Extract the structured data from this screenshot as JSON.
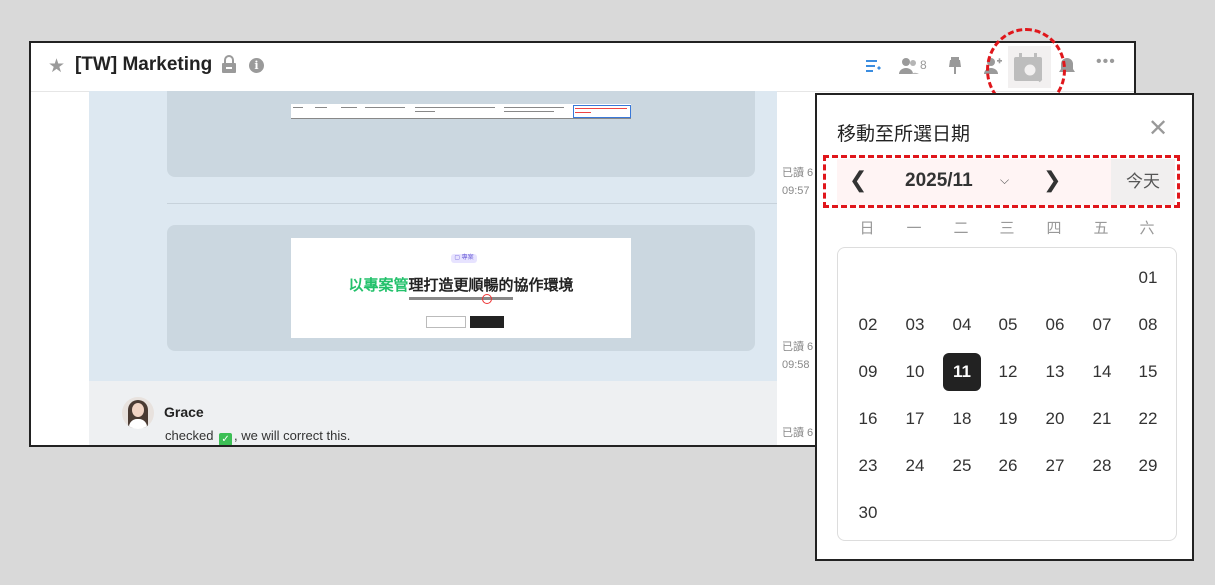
{
  "header": {
    "title": "[TW] Marketing",
    "member_count": "8"
  },
  "messages": {
    "promo_badge": "▢ 專案",
    "promo_headline_green": "以專案管",
    "promo_headline_rest": "理打造更順暢的協作環境",
    "read1": "已讀 6",
    "time1": "09:57",
    "read2": "已讀 6",
    "time2": "09:58",
    "read3": "已讀 6",
    "sender": "Grace",
    "msg_before": "checked",
    "msg_after": ", we will correct this."
  },
  "date_picker": {
    "title": "移動至所選日期",
    "year_month": "2025/11",
    "today_label": "今天",
    "weekdays": [
      "日",
      "一",
      "二",
      "三",
      "四",
      "五",
      "六"
    ],
    "selected_day": "11",
    "days": [
      "01",
      "02",
      "03",
      "04",
      "05",
      "06",
      "07",
      "08",
      "09",
      "10",
      "11",
      "12",
      "13",
      "14",
      "15",
      "16",
      "17",
      "18",
      "19",
      "20",
      "21",
      "22",
      "23",
      "24",
      "25",
      "26",
      "27",
      "28",
      "29",
      "30"
    ]
  },
  "colors": {
    "highlight_red": "#e0161b",
    "accent_blue": "#3b8de0",
    "promo_green": "#23c16b",
    "check_green": "#3cbf55"
  }
}
